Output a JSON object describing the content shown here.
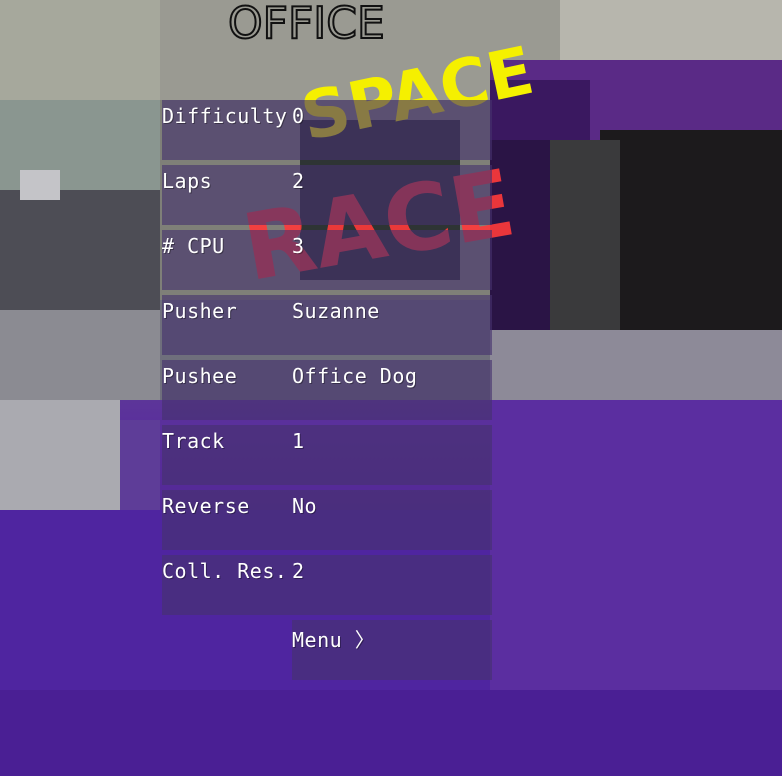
{
  "logo": {
    "line1": "OFFICE",
    "line2": "SPACE",
    "line3": "RACE",
    "colors": {
      "line1": "#111111",
      "line2": "#f5f000",
      "line3": "#ff3a3a"
    }
  },
  "menu": {
    "rows": [
      {
        "label": "Difficulty",
        "value": "0"
      },
      {
        "label": "Laps",
        "value": "2"
      },
      {
        "label": "# CPU",
        "value": "3"
      },
      {
        "label": "Pusher",
        "value": "Suzanne"
      },
      {
        "label": "Pushee",
        "value": "Office Dog"
      },
      {
        "label": "Track",
        "value": "1"
      },
      {
        "label": "Reverse",
        "value": "No"
      },
      {
        "label": "Coll. Res.",
        "value": "2"
      }
    ],
    "menu_button": "Menu 〉"
  }
}
